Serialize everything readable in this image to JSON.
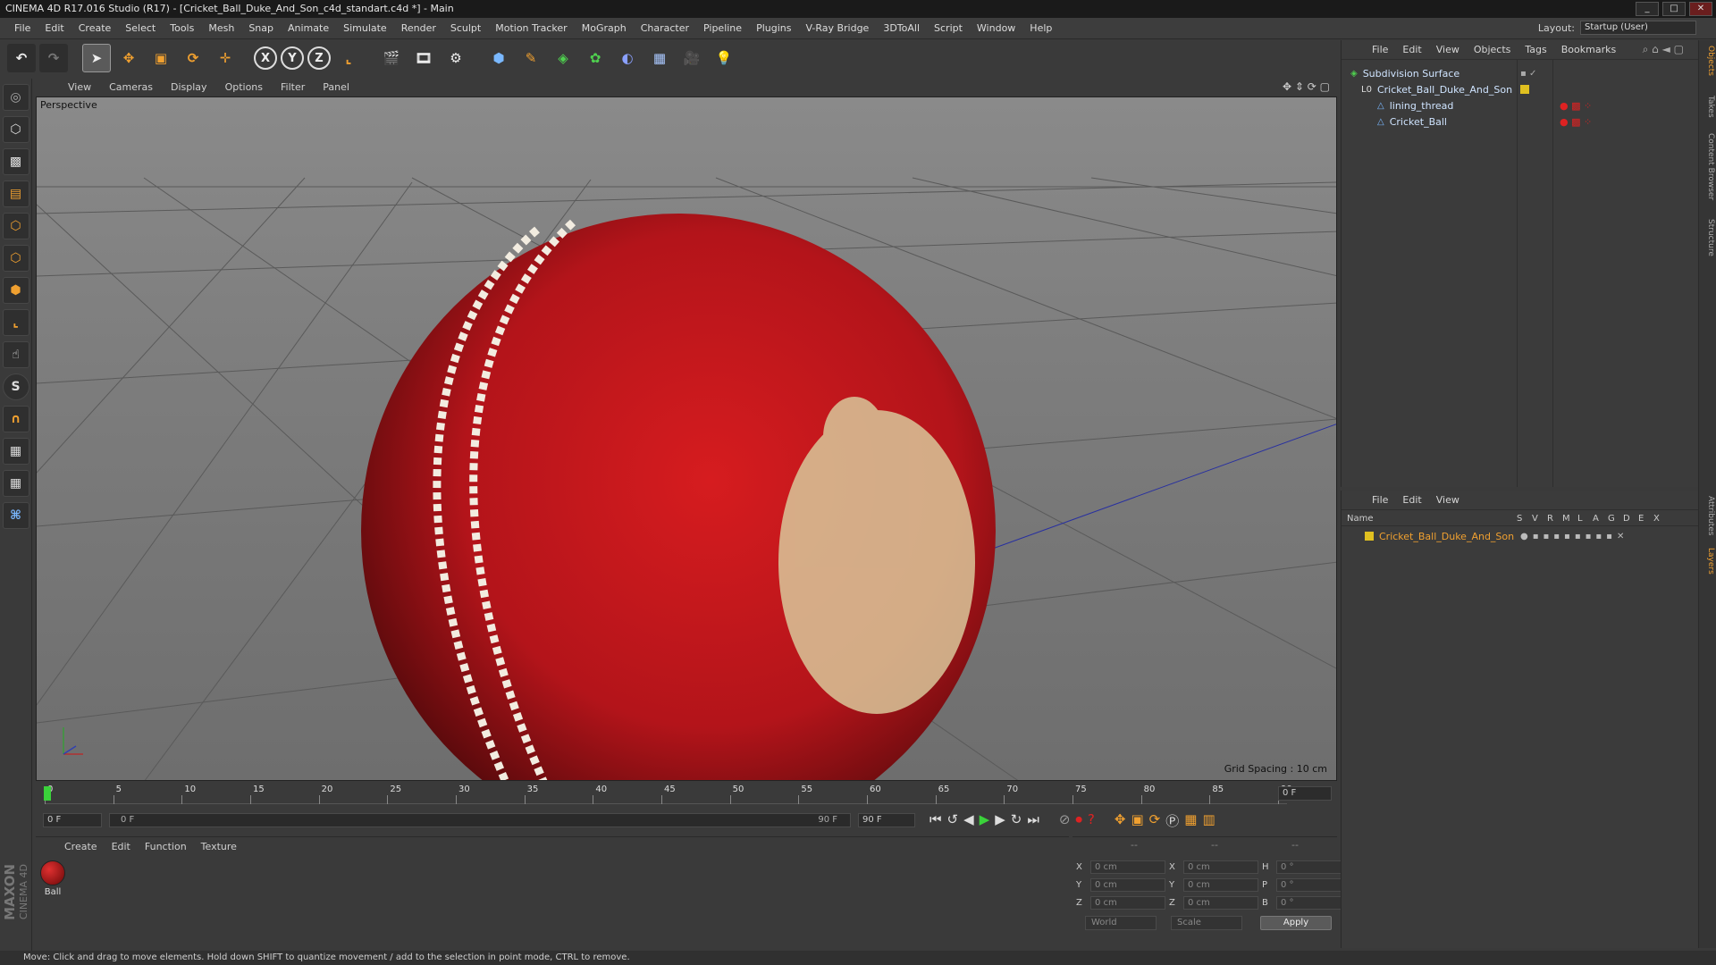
{
  "window": {
    "title": "CINEMA 4D R17.016 Studio (R17) - [Cricket_Ball_Duke_And_Son_c4d_standart.c4d *] - Main"
  },
  "menubar": {
    "items": [
      "File",
      "Edit",
      "Create",
      "Select",
      "Tools",
      "Mesh",
      "Snap",
      "Animate",
      "Simulate",
      "Render",
      "Sculpt",
      "Motion Tracker",
      "MoGraph",
      "Character",
      "Pipeline",
      "Plugins",
      "V-Ray Bridge",
      "3DToAll",
      "Script",
      "Window",
      "Help"
    ],
    "layout_label": "Layout:",
    "layout_value": "Startup (User)"
  },
  "toolbar": {
    "x_label": "X",
    "y_label": "Y",
    "z_label": "Z"
  },
  "viewport": {
    "menu": [
      "View",
      "Cameras",
      "Display",
      "Options",
      "Filter",
      "Panel"
    ],
    "view_name": "Perspective",
    "grid_spacing": "Grid Spacing : 10 cm"
  },
  "timeline": {
    "ticks": [
      "0",
      "5",
      "10",
      "15",
      "20",
      "25",
      "30",
      "35",
      "40",
      "45",
      "50",
      "55",
      "60",
      "65",
      "70",
      "75",
      "80",
      "85",
      "90"
    ],
    "current_frame": "0 F",
    "start_frame": "0 F",
    "range_start": "0 F",
    "range_end": "90 F",
    "end_frame": "90 F"
  },
  "material_manager": {
    "menu": [
      "Create",
      "Edit",
      "Function",
      "Texture"
    ],
    "materials": [
      {
        "name": "Ball"
      }
    ]
  },
  "coordinates": {
    "header": [
      "--",
      "--",
      "--"
    ],
    "pos_labels": [
      "X",
      "Y",
      "Z"
    ],
    "pos_values": [
      "0 cm",
      "0 cm",
      "0 cm"
    ],
    "size_labels": [
      "X",
      "Y",
      "Z"
    ],
    "size_values": [
      "0 cm",
      "0 cm",
      "0 cm"
    ],
    "rot_labels": [
      "H",
      "P",
      "B"
    ],
    "rot_values": [
      "0 °",
      "0 °",
      "0 °"
    ],
    "world_option": "World",
    "scale_option": "Scale",
    "apply_label": "Apply"
  },
  "object_manager": {
    "menu": [
      "File",
      "Edit",
      "View",
      "Objects",
      "Tags",
      "Bookmarks"
    ],
    "objects": [
      {
        "name": "Subdivision Surface"
      },
      {
        "name": "Cricket_Ball_Duke_And_Son"
      },
      {
        "name": "lining_thread"
      },
      {
        "name": "Cricket_Ball"
      }
    ]
  },
  "layer_manager": {
    "menu": [
      "File",
      "Edit",
      "View"
    ],
    "columns": [
      "Name",
      "S",
      "V",
      "R",
      "M",
      "L",
      "A",
      "G",
      "D",
      "E",
      "X"
    ],
    "layers": [
      {
        "name": "Cricket_Ball_Duke_And_Son",
        "color": "#e0c020"
      }
    ]
  },
  "side_tabs": [
    "Objects",
    "Takes",
    "Content Browser",
    "Structure",
    "Attributes",
    "Layers"
  ],
  "branding": {
    "line1": "MAXON",
    "line2": "CINEMA 4D"
  },
  "status": {
    "text": "Move: Click and drag to move elements. Hold down SHIFT to quantize movement / add to the selection in point mode, CTRL to remove."
  },
  "colors": {
    "ball_red": "#c4161c",
    "accent_orange": "#f0a030",
    "layer_yellow": "#e0c020",
    "selection_text": "#f0a030"
  }
}
